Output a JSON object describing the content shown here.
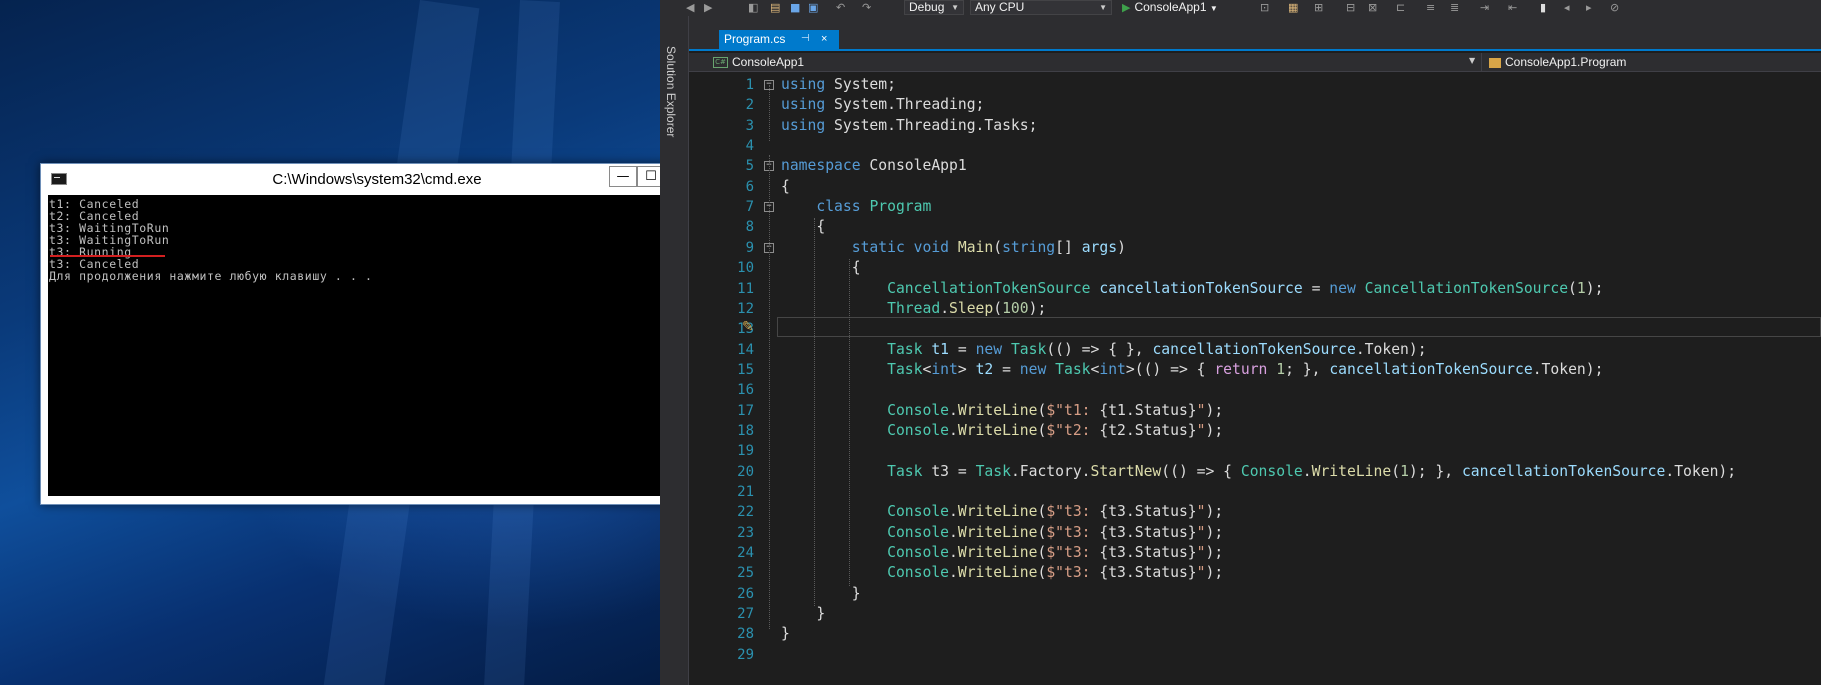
{
  "console_window": {
    "title": "C:\\Windows\\system32\\cmd.exe",
    "controls": {
      "minimize": "—",
      "maximize": "☐",
      "close": "✕"
    },
    "lines": [
      "t1: Canceled",
      "t2: Canceled",
      "t3: WaitingToRun",
      "t3: WaitingToRun",
      "t3: Running",
      "t3: Canceled",
      "Для продолжения нажмите любую клавишу . . ."
    ]
  },
  "vs": {
    "toolbar": {
      "configuration": "Debug",
      "platform": "Any CPU",
      "start_target": "ConsoleApp1"
    },
    "side_panel": {
      "label": "Solution Explorer"
    },
    "tab": {
      "label": "Program.cs",
      "pin": "⊣",
      "close": "×"
    },
    "navbar": {
      "project": "ConsoleApp1",
      "project_icon": "C#",
      "class": "ConsoleApp1.Program"
    },
    "line_numbers": [
      "1",
      "2",
      "3",
      "4",
      "5",
      "6",
      "7",
      "8",
      "9",
      "10",
      "11",
      "12",
      "13",
      "14",
      "15",
      "16",
      "17",
      "18",
      "19",
      "20",
      "21",
      "22",
      "23",
      "24",
      "25",
      "26",
      "27",
      "28",
      "29"
    ],
    "code_lines": [
      [
        {
          "t": "using",
          "c": "kw"
        },
        {
          "t": " System;"
        }
      ],
      [
        {
          "t": "using",
          "c": "kw"
        },
        {
          "t": " System.Threading;"
        }
      ],
      [
        {
          "t": "using",
          "c": "kw"
        },
        {
          "t": " System.Threading.Tasks;"
        }
      ],
      [],
      [
        {
          "t": "namespace",
          "c": "kw"
        },
        {
          "t": " ConsoleApp1"
        }
      ],
      [
        {
          "t": "{"
        }
      ],
      [
        {
          "t": "    "
        },
        {
          "t": "class",
          "c": "kw"
        },
        {
          "t": " "
        },
        {
          "t": "Program",
          "c": "ty"
        }
      ],
      [
        {
          "t": "    {"
        }
      ],
      [
        {
          "t": "        "
        },
        {
          "t": "static",
          "c": "kw"
        },
        {
          "t": " "
        },
        {
          "t": "void",
          "c": "kw"
        },
        {
          "t": " "
        },
        {
          "t": "Main",
          "c": "me"
        },
        {
          "t": "("
        },
        {
          "t": "string",
          "c": "kw"
        },
        {
          "t": "[] "
        },
        {
          "t": "args",
          "c": "pa"
        },
        {
          "t": ")"
        }
      ],
      [
        {
          "t": "        {"
        }
      ],
      [
        {
          "t": "            "
        },
        {
          "t": "CancellationTokenSource",
          "c": "ty"
        },
        {
          "t": " "
        },
        {
          "t": "cancellationTokenSource",
          "c": "pa"
        },
        {
          "t": " = "
        },
        {
          "t": "new",
          "c": "kw"
        },
        {
          "t": " "
        },
        {
          "t": "CancellationTokenSource",
          "c": "ty"
        },
        {
          "t": "("
        },
        {
          "t": "1",
          "c": "nu"
        },
        {
          "t": ");"
        }
      ],
      [
        {
          "t": "            "
        },
        {
          "t": "Thread",
          "c": "ty"
        },
        {
          "t": "."
        },
        {
          "t": "Sleep",
          "c": "me"
        },
        {
          "t": "("
        },
        {
          "t": "100",
          "c": "nu"
        },
        {
          "t": ");"
        }
      ],
      [],
      [
        {
          "t": "            "
        },
        {
          "t": "Task",
          "c": "ty"
        },
        {
          "t": " "
        },
        {
          "t": "t1",
          "c": "pa"
        },
        {
          "t": " = "
        },
        {
          "t": "new",
          "c": "kw"
        },
        {
          "t": " "
        },
        {
          "t": "Task",
          "c": "ty"
        },
        {
          "t": "(() => { }, "
        },
        {
          "t": "cancellationTokenSource",
          "c": "pa"
        },
        {
          "t": ".Token);"
        }
      ],
      [
        {
          "t": "            "
        },
        {
          "t": "Task",
          "c": "ty"
        },
        {
          "t": "<"
        },
        {
          "t": "int",
          "c": "kw"
        },
        {
          "t": "> "
        },
        {
          "t": "t2",
          "c": "pa"
        },
        {
          "t": " = "
        },
        {
          "t": "new",
          "c": "kw"
        },
        {
          "t": " "
        },
        {
          "t": "Task",
          "c": "ty"
        },
        {
          "t": "<"
        },
        {
          "t": "int",
          "c": "kw"
        },
        {
          "t": ">(() => { "
        },
        {
          "t": "return",
          "c": "fl"
        },
        {
          "t": " "
        },
        {
          "t": "1",
          "c": "nu"
        },
        {
          "t": "; }, "
        },
        {
          "t": "cancellationTokenSource",
          "c": "pa"
        },
        {
          "t": ".Token);"
        }
      ],
      [],
      [
        {
          "t": "            "
        },
        {
          "t": "Console",
          "c": "ty"
        },
        {
          "t": "."
        },
        {
          "t": "WriteLine",
          "c": "me"
        },
        {
          "t": "("
        },
        {
          "t": "$\"t1: ",
          "c": "st"
        },
        {
          "t": "{t1.Status}"
        },
        {
          "t": "\"",
          "c": "st"
        },
        {
          "t": ");"
        }
      ],
      [
        {
          "t": "            "
        },
        {
          "t": "Console",
          "c": "ty"
        },
        {
          "t": "."
        },
        {
          "t": "WriteLine",
          "c": "me"
        },
        {
          "t": "("
        },
        {
          "t": "$\"t2: ",
          "c": "st"
        },
        {
          "t": "{t2.Status}"
        },
        {
          "t": "\"",
          "c": "st"
        },
        {
          "t": ");"
        }
      ],
      [],
      [
        {
          "t": "            "
        },
        {
          "t": "Task",
          "c": "ty"
        },
        {
          "t": " t3 = "
        },
        {
          "t": "Task",
          "c": "ty"
        },
        {
          "t": ".Factory."
        },
        {
          "t": "StartNew",
          "c": "me"
        },
        {
          "t": "(() => { "
        },
        {
          "t": "Console",
          "c": "ty"
        },
        {
          "t": "."
        },
        {
          "t": "WriteLine",
          "c": "me"
        },
        {
          "t": "("
        },
        {
          "t": "1",
          "c": "nu"
        },
        {
          "t": "); }, "
        },
        {
          "t": "cancellationTokenSource",
          "c": "pa"
        },
        {
          "t": ".Token);"
        }
      ],
      [],
      [
        {
          "t": "            "
        },
        {
          "t": "Console",
          "c": "ty"
        },
        {
          "t": "."
        },
        {
          "t": "WriteLine",
          "c": "me"
        },
        {
          "t": "("
        },
        {
          "t": "$\"t3: ",
          "c": "st"
        },
        {
          "t": "{t3.Status}"
        },
        {
          "t": "\"",
          "c": "st"
        },
        {
          "t": ");"
        }
      ],
      [
        {
          "t": "            "
        },
        {
          "t": "Console",
          "c": "ty"
        },
        {
          "t": "."
        },
        {
          "t": "WriteLine",
          "c": "me"
        },
        {
          "t": "("
        },
        {
          "t": "$\"t3: ",
          "c": "st"
        },
        {
          "t": "{t3.Status}"
        },
        {
          "t": "\"",
          "c": "st"
        },
        {
          "t": ");"
        }
      ],
      [
        {
          "t": "            "
        },
        {
          "t": "Console",
          "c": "ty"
        },
        {
          "t": "."
        },
        {
          "t": "WriteLine",
          "c": "me"
        },
        {
          "t": "("
        },
        {
          "t": "$\"t3: ",
          "c": "st"
        },
        {
          "t": "{t3.Status}"
        },
        {
          "t": "\"",
          "c": "st"
        },
        {
          "t": ");"
        }
      ],
      [
        {
          "t": "            "
        },
        {
          "t": "Console",
          "c": "ty"
        },
        {
          "t": "."
        },
        {
          "t": "WriteLine",
          "c": "me"
        },
        {
          "t": "("
        },
        {
          "t": "$\"t3: ",
          "c": "st"
        },
        {
          "t": "{t3.Status}"
        },
        {
          "t": "\"",
          "c": "st"
        },
        {
          "t": ");"
        }
      ],
      [
        {
          "t": "        }"
        }
      ],
      [
        {
          "t": "    }"
        }
      ],
      [
        {
          "t": "}"
        }
      ],
      []
    ],
    "fold_marker": "−",
    "colors": {
      "keyword": "#569cd6",
      "type": "#4ec9b0",
      "method": "#dcdcaa",
      "identifier": "#9cdcfe",
      "string": "#d69d85",
      "number": "#b5cea8",
      "accent": "#007acc"
    }
  }
}
